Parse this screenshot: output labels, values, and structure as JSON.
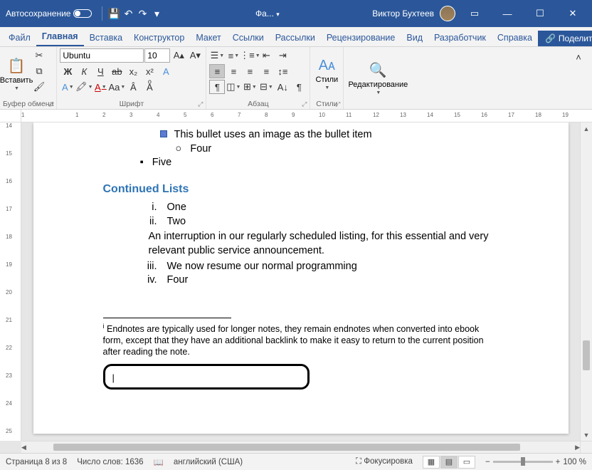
{
  "titlebar": {
    "autosave": "Автосохранение",
    "doc_name": "Фа...",
    "user": "Виктор Бухтеев"
  },
  "tabs": {
    "file": "Файл",
    "home": "Главная",
    "insert": "Вставка",
    "design": "Конструктор",
    "layout": "Макет",
    "references": "Ссылки",
    "mailings": "Рассылки",
    "review": "Рецензирование",
    "view": "Вид",
    "developer": "Разработчик",
    "help": "Справка",
    "share": "Поделиться"
  },
  "ribbon": {
    "clipboard": {
      "label": "Буфер обмена",
      "paste": "Вставить"
    },
    "font": {
      "label": "Шрифт",
      "name": "Ubuntu",
      "size": "10"
    },
    "paragraph": {
      "label": "Абзац"
    },
    "styles": {
      "label": "Стили",
      "btn": "Стили"
    },
    "editing": {
      "label": "",
      "btn": "Редактирование"
    }
  },
  "doc": {
    "bullet_image": "This bullet uses an image as the bullet item",
    "four": "Four",
    "five": "Five",
    "heading": "Continued Lists",
    "items": [
      {
        "n": "i.",
        "t": "One"
      },
      {
        "n": "ii.",
        "t": "Two"
      }
    ],
    "interrupt": "An interruption in our regularly scheduled listing, for this essential and very relevant public service announcement.",
    "items2": [
      {
        "n": "iii.",
        "t": "We now resume our normal programming"
      },
      {
        "n": "iv.",
        "t": "Four"
      }
    ],
    "endnote": "Endnotes are typically used for longer notes, they remain endnotes when converted into ebook form, except that they have an additional backlink to make it easy to return to the current position after reading the note."
  },
  "status": {
    "page": "Страница 8 из 8",
    "words": "Число слов: 1636",
    "lang": "английский (США)",
    "focus": "Фокусировка",
    "zoom": "100 %"
  },
  "ruler_h": [
    "1",
    "",
    "1",
    "2",
    "3",
    "4",
    "5",
    "6",
    "7",
    "8",
    "9",
    "10",
    "11",
    "12",
    "13",
    "14",
    "15",
    "16",
    "17",
    "18",
    "19"
  ],
  "ruler_v": [
    "14",
    "",
    "",
    "15",
    "",
    "",
    "16",
    "",
    "",
    "17",
    "",
    "",
    "18",
    "",
    "",
    "19",
    "",
    "",
    "20",
    "",
    "",
    "21",
    "",
    "",
    "22",
    "",
    "",
    "23",
    "",
    "",
    "24",
    "",
    "",
    "25"
  ]
}
